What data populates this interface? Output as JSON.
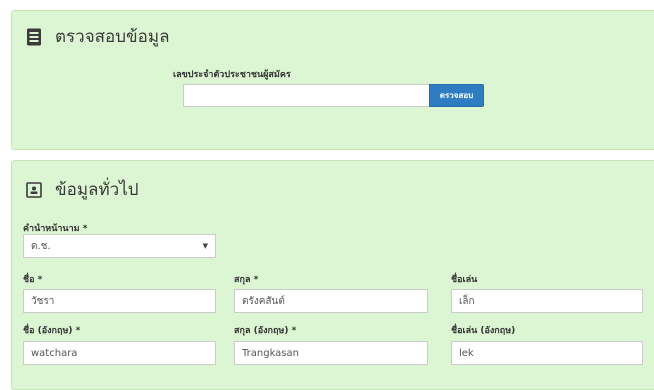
{
  "verify": {
    "title": "ตรวจสอบข้อมูล",
    "id_label": "เลขประจำตัวประชาชนผู้สมัคร",
    "id_value": "",
    "check_button": "ตรวจสอบ"
  },
  "general": {
    "title": "ข้อมูลทั่วไป",
    "title_prefix_label": "คำนำหน้านาม *",
    "title_prefix_value": "ด.ช.",
    "first_name_label": "ชื่อ *",
    "first_name_value": "วัชรา",
    "last_name_label": "สกุล *",
    "last_name_value": "ตรังคสันต์",
    "nickname_label": "ชื่อเล่น",
    "nickname_value": "เล็ก",
    "first_name_en_label": "ชื่อ (อังกฤษ) *",
    "first_name_en_value": "watchara",
    "last_name_en_label": "สกุล (อังกฤษ) *",
    "last_name_en_value": "Trangkasan",
    "nickname_en_label": "ชื่อเล่น (อังกฤษ)",
    "nickname_en_value": "lek"
  },
  "icons": {
    "verify_icon": "address-book-icon",
    "general_icon": "id-card-icon",
    "dropdown_icon": "caret-down-icon"
  },
  "colors": {
    "panel_bg": "#dcf5d2",
    "button_bg": "#2e7cc1"
  }
}
